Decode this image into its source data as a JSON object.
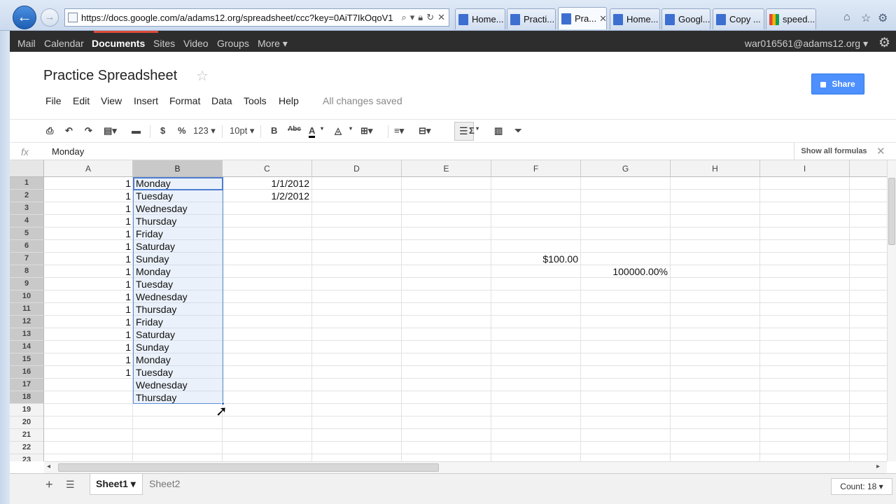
{
  "browser": {
    "address": "https://docs.google.com/a/adams12.org/spreadsheet/ccc?key=0AiT7IkOqoV1",
    "tabs": [
      {
        "label": "Home...",
        "favicon": "docs"
      },
      {
        "label": "Practi...",
        "favicon": "docs"
      },
      {
        "label": "Pra...",
        "favicon": "docs"
      },
      {
        "label": "Home...",
        "favicon": "docs"
      },
      {
        "label": "Googl...",
        "favicon": "docs"
      },
      {
        "label": "Copy ...",
        "favicon": "docs"
      },
      {
        "label": "speed...",
        "favicon": "google"
      }
    ],
    "tab_close": "✕"
  },
  "gbar": {
    "items": [
      "Mail",
      "Calendar",
      "Documents",
      "Sites",
      "Video",
      "Groups",
      "More ▾"
    ],
    "user": "war016561@adams12.org ▾"
  },
  "doc": {
    "title": "Practice Spreadsheet",
    "share_label": "Share",
    "menu": [
      "File",
      "Edit",
      "View",
      "Insert",
      "Format",
      "Data",
      "Tools",
      "Help"
    ],
    "save_status": "All changes saved"
  },
  "toolbar": {
    "currency": "$",
    "percent": "%",
    "number_format": "123 ▾",
    "font_size": "10pt ▾",
    "bold": "B",
    "strike": "Abc",
    "text_color": "A",
    "sum": "Σ"
  },
  "formula_bar": {
    "fx": "fx",
    "value": "Monday",
    "show_formulas": "Show all formulas"
  },
  "grid": {
    "columns": [
      "A",
      "B",
      "C",
      "D",
      "E",
      "F",
      "G",
      "H",
      "I"
    ],
    "rows": [
      "1",
      "2",
      "3",
      "4",
      "5",
      "6",
      "7",
      "8",
      "9",
      "10",
      "11",
      "12",
      "13",
      "14",
      "15",
      "16",
      "17",
      "18",
      "19",
      "20",
      "21",
      "22",
      "23"
    ],
    "col_a": [
      "1",
      "1",
      "1",
      "1",
      "1",
      "1",
      "1",
      "1",
      "1",
      "1",
      "1",
      "1",
      "1",
      "1",
      "1",
      "1",
      "",
      ""
    ],
    "col_b": [
      "Monday",
      "Tuesday",
      "Wednesday",
      "Thursday",
      "Friday",
      "Saturday",
      "Sunday",
      "Monday",
      "Tuesday",
      "Wednesday",
      "Thursday",
      "Friday",
      "Saturday",
      "Sunday",
      "Monday",
      "Tuesday",
      "Wednesday",
      "Thursday"
    ],
    "col_c": [
      "1/1/2012",
      "1/2/2012"
    ],
    "f7": "$100.00",
    "g8": "100000.00%",
    "selected_column": "B",
    "active_cell": "B1"
  },
  "sheets": {
    "tabs": [
      "Sheet1 ▾",
      "Sheet2"
    ],
    "active": "Sheet1",
    "count": "Count: 18 ▾"
  }
}
